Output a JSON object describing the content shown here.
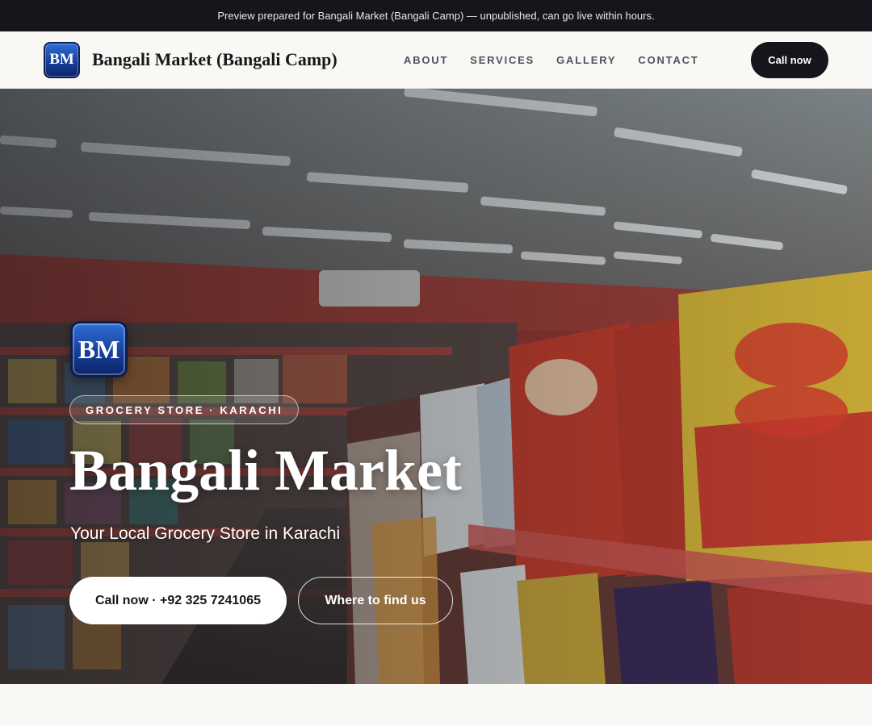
{
  "preview_banner": {
    "text": "Preview prepared for Bangali Market (Bangali Camp) — unpublished, can go live within hours."
  },
  "header": {
    "logo_initials": "BM",
    "brand_name": "Bangali Market (Bangali Camp)",
    "nav": [
      "ABOUT",
      "SERVICES",
      "GALLERY",
      "CONTACT"
    ],
    "call_label": "Call now"
  },
  "hero": {
    "logo_initials": "BM",
    "category_pill": "GROCERY STORE · KARACHI",
    "title": "Bangali Market",
    "subtitle": "Your Local Grocery Store in Karachi",
    "primary_cta": "Call now · +92 325 7241065",
    "secondary_cta": "Where to find us",
    "background_image": "grocery-store-aisle-photo"
  },
  "colors": {
    "dark": "#14161b",
    "logo_blue": "#1f4fb5",
    "page_bg": "#f9f8f5"
  }
}
